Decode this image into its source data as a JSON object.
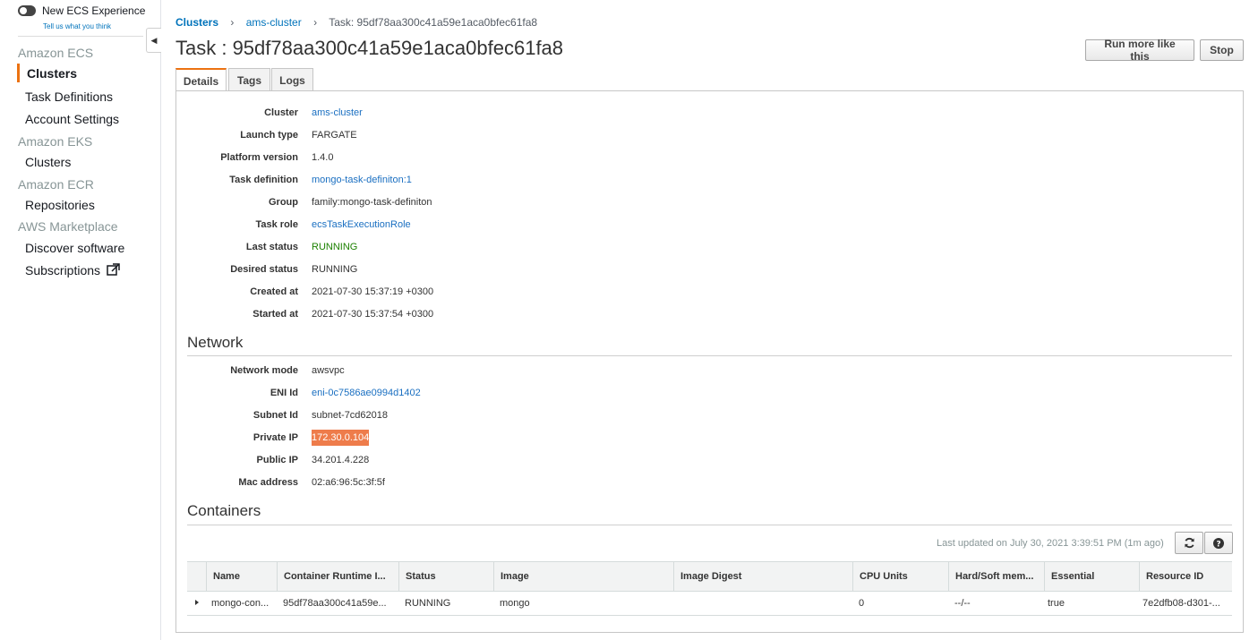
{
  "sidebar": {
    "toggle_label": "New ECS Experience",
    "tell_link": "Tell us what you think",
    "sections": [
      {
        "title": "Amazon ECS",
        "items": [
          "Clusters",
          "Task Definitions",
          "Account Settings"
        ]
      },
      {
        "title": "Amazon EKS",
        "items": [
          "Clusters"
        ]
      },
      {
        "title": "Amazon ECR",
        "items": [
          "Repositories"
        ]
      },
      {
        "title": "AWS Marketplace",
        "items": [
          "Discover software",
          "Subscriptions"
        ]
      }
    ],
    "active_item": "Clusters",
    "accent_color": "#ec7211"
  },
  "breadcrumb": {
    "clusters": "Clusters",
    "cluster": "ams-cluster",
    "current": "Task: 95df78aa300c41a59e1aca0bfec61fa8"
  },
  "page": {
    "title": "Task : 95df78aa300c41a59e1aca0bfec61fa8",
    "run_more_button": "Run more like this",
    "stop_button": "Stop"
  },
  "tabs": [
    "Details",
    "Tags",
    "Logs"
  ],
  "details": {
    "cluster_label": "Cluster",
    "cluster_value": "ams-cluster",
    "launch_type_label": "Launch type",
    "launch_type_value": "FARGATE",
    "platform_label": "Platform version",
    "platform_value": "1.4.0",
    "task_def_label": "Task definition",
    "task_def_value": "mongo-task-definiton:1",
    "group_label": "Group",
    "group_value": "family:mongo-task-definiton",
    "task_role_label": "Task role",
    "task_role_value": "ecsTaskExecutionRole",
    "last_status_label": "Last status",
    "last_status_value": "RUNNING",
    "desired_status_label": "Desired status",
    "desired_status_value": "RUNNING",
    "created_label": "Created at",
    "created_value": "2021-07-30 15:37:19 +0300",
    "started_label": "Started at",
    "started_value": "2021-07-30 15:37:54 +0300"
  },
  "network": {
    "title": "Network",
    "mode_label": "Network mode",
    "mode_value": "awsvpc",
    "eni_label": "ENI Id",
    "eni_value": "eni-0c7586ae0994d1402",
    "subnet_label": "Subnet Id",
    "subnet_value": "subnet-7cd62018",
    "private_ip_label": "Private IP",
    "private_ip_value": "172.30.0.104",
    "public_ip_label": "Public IP",
    "public_ip_value": "34.201.4.228",
    "mac_label": "Mac address",
    "mac_value": "02:a6:96:5c:3f:5f"
  },
  "containers": {
    "title": "Containers",
    "last_updated": "Last updated on July 30, 2021 3:39:51 PM (1m ago)",
    "columns": [
      "Name",
      "Container Runtime I...",
      "Status",
      "Image",
      "Image Digest",
      "CPU Units",
      "Hard/Soft mem...",
      "Essential",
      "Resource ID"
    ],
    "rows": [
      {
        "name": "mongo-con...",
        "runtime_id": "95df78aa300c41a59e...",
        "status": "RUNNING",
        "image": "mongo",
        "digest": "",
        "cpu": "0",
        "memory": "--/--",
        "essential": "true",
        "resource_id": "7e2dfb08-d301-..."
      }
    ]
  }
}
